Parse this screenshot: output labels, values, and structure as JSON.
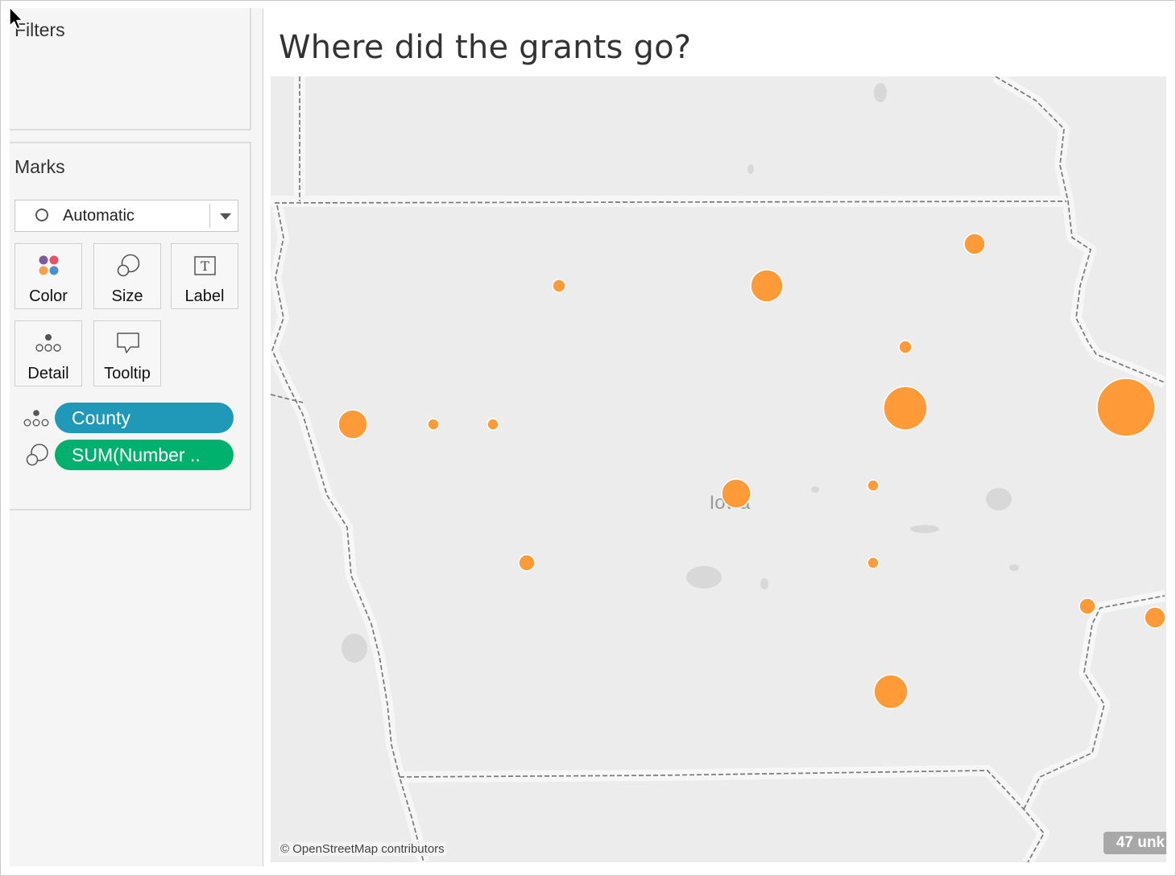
{
  "sidebar": {
    "filters": {
      "title": "Filters"
    },
    "marks": {
      "title": "Marks",
      "mark_type": "Automatic",
      "buttons": [
        {
          "label": "Color",
          "icon": "color-dots-icon"
        },
        {
          "label": "Size",
          "icon": "size-circles-icon"
        },
        {
          "label": "Label",
          "icon": "text-t-icon"
        },
        {
          "label": "Detail",
          "icon": "detail-dots-icon"
        },
        {
          "label": "Tooltip",
          "icon": "speech-bubble-icon"
        }
      ],
      "pills": [
        {
          "label": "County",
          "icon": "detail-dots-icon",
          "color": "#1f99b7"
        },
        {
          "label": "SUM(Number ..",
          "icon": "size-circles-icon",
          "color": "#00b16e"
        }
      ]
    }
  },
  "viz": {
    "title": "Where did the grants go?",
    "map": {
      "region_label": "Iowa",
      "attribution": "© OpenStreetMap contributors",
      "unknown_indicator": "47 unk",
      "mark_color": "#fe9b38",
      "land_color": "#ececec",
      "border_color": "#777777"
    }
  }
}
